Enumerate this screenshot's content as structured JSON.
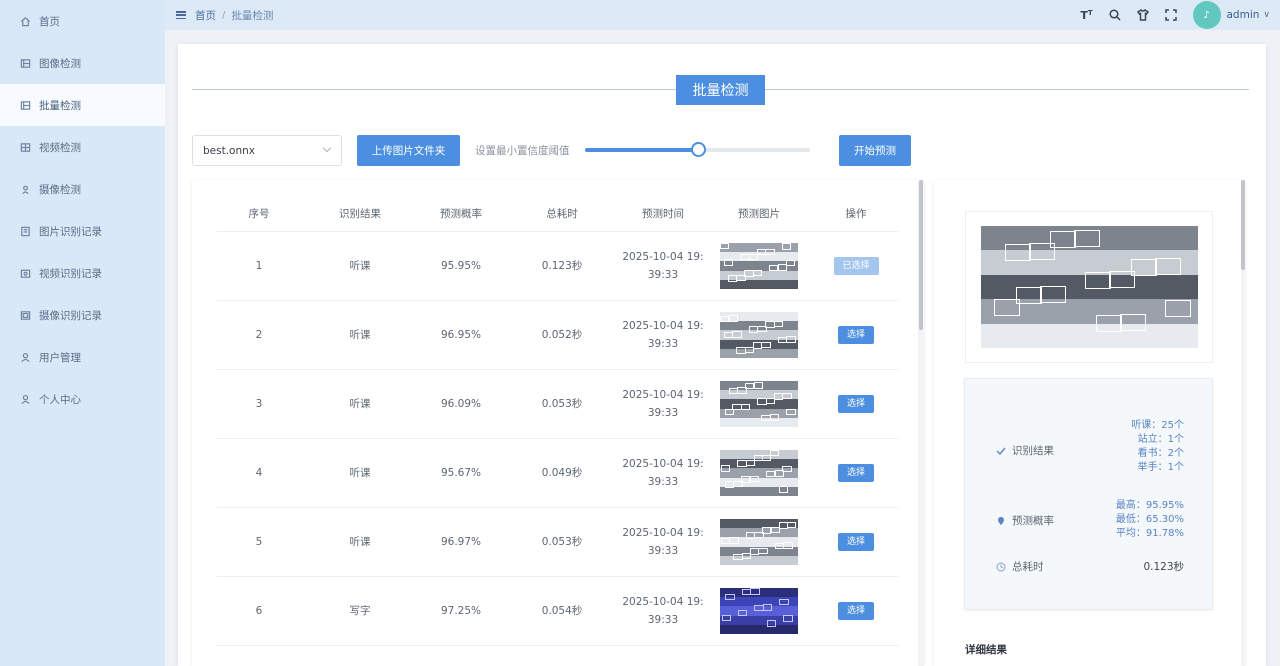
{
  "sidebar": {
    "items": [
      {
        "label": "首页",
        "icon": "home-icon"
      },
      {
        "label": "图像检测",
        "icon": "image-icon"
      },
      {
        "label": "批量检测",
        "icon": "image-icon",
        "active": true
      },
      {
        "label": "视频检测",
        "icon": "video-icon"
      },
      {
        "label": "摄像检测",
        "icon": "camera-icon"
      },
      {
        "label": "图片识别记录",
        "icon": "document-icon"
      },
      {
        "label": "视频识别记录",
        "icon": "video-record-icon"
      },
      {
        "label": "摄像识别记录",
        "icon": "camera-record-icon"
      },
      {
        "label": "用户管理",
        "icon": "user-icon"
      },
      {
        "label": "个人中心",
        "icon": "user-icon"
      }
    ]
  },
  "header": {
    "breadcrumb": [
      "首页",
      "批量检测"
    ],
    "user": "admin",
    "icons": [
      "font-size-icon",
      "search-icon",
      "shirt-icon",
      "fullscreen-icon"
    ]
  },
  "main": {
    "title": "批量检测",
    "model_select": "best.onnx",
    "upload_label": "上传图片文件夹",
    "threshold_label": "设置最小置信度阈值",
    "threshold_value": 0.5,
    "start_label": "开始预测",
    "table": {
      "headers": [
        "序号",
        "识别结果",
        "预测概率",
        "总耗时",
        "预测时间",
        "预测图片",
        "操作"
      ],
      "rows": [
        {
          "id": "1",
          "result": "听课",
          "prob": "95.95%",
          "time": "0.123秒",
          "date1": "2025-10-04 19:",
          "date2": "39:33",
          "action": "已选择",
          "selected": true
        },
        {
          "id": "2",
          "result": "听课",
          "prob": "96.95%",
          "time": "0.052秒",
          "date1": "2025-10-04 19:",
          "date2": "39:33",
          "action": "选择"
        },
        {
          "id": "3",
          "result": "听课",
          "prob": "96.09%",
          "time": "0.053秒",
          "date1": "2025-10-04 19:",
          "date2": "39:33",
          "action": "选择"
        },
        {
          "id": "4",
          "result": "听课",
          "prob": "95.67%",
          "time": "0.049秒",
          "date1": "2025-10-04 19:",
          "date2": "39:33",
          "action": "选择"
        },
        {
          "id": "5",
          "result": "听课",
          "prob": "96.97%",
          "time": "0.053秒",
          "date1": "2025-10-04 19:",
          "date2": "39:33",
          "action": "选择"
        },
        {
          "id": "6",
          "result": "写字",
          "prob": "97.25%",
          "time": "0.054秒",
          "date1": "2025-10-04 19:",
          "date2": "39:33",
          "action": "选择"
        }
      ]
    }
  },
  "details": {
    "result_label": "识别结果",
    "result_values": [
      "听课：25个",
      "站立：1个",
      "看书：2个",
      "举手：1个"
    ],
    "prob_label": "预测概率",
    "prob_values": [
      "最高：95.95%",
      "最低：65.30%",
      "平均：91.78%"
    ],
    "time_label": "总耗时",
    "time_value": "0.123秒",
    "detail_title": "详细结果"
  },
  "colors": {
    "accent": "#4c8fe0",
    "sidebar": "#d9e8f7",
    "header": "#dce9f7"
  }
}
